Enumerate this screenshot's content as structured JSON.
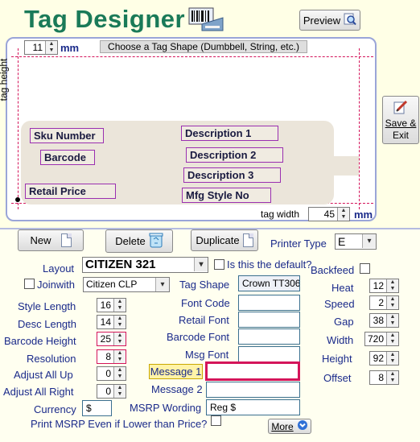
{
  "app": {
    "title": "Tag Designer"
  },
  "toolbar": {
    "preview_label": "Preview",
    "save_exit_label_1": "Save &",
    "save_exit_label_2": "Exit"
  },
  "canvas": {
    "height_value": "11",
    "height_unit": "mm",
    "height_axis_label": "tag height",
    "shape_hint": "Choose a Tag Shape (Dumbbell, String, etc.)",
    "width_label": "tag width",
    "width_value": "45",
    "width_unit": "mm",
    "fields": {
      "sku": "Sku Number",
      "barcode": "Barcode",
      "retail_price": "Retail Price",
      "desc1": "Description 1",
      "desc2": "Description 2",
      "desc3": "Description 3",
      "mfg_style": "Mfg Style No"
    }
  },
  "actions": {
    "new": "New",
    "delete": "Delete",
    "duplicate": "Duplicate"
  },
  "printer": {
    "label": "Printer Type",
    "value": "E"
  },
  "layout": {
    "label": "Layout",
    "value": "CITIZEN 321",
    "default_label": "Is this the default?",
    "joinwith_label": "Joinwith",
    "joinwith_value": "Citizen CLP"
  },
  "left_fields": {
    "style_length": {
      "label": "Style Length",
      "value": "16"
    },
    "desc_length": {
      "label": "Desc Length",
      "value": "14"
    },
    "barcode_height": {
      "label": "Barcode Height",
      "value": "25"
    },
    "resolution": {
      "label": "Resolution",
      "value": "8"
    },
    "adjust_up": {
      "label": "Adjust All Up",
      "value": "0"
    },
    "adjust_right": {
      "label": "Adjust All Right",
      "value": "0"
    },
    "currency": {
      "label": "Currency",
      "value": "$"
    }
  },
  "mid_fields": {
    "tag_shape": {
      "label": "Tag Shape",
      "value": "Crown TT306"
    },
    "font_code": {
      "label": "Font Code",
      "value": ""
    },
    "retail_font": {
      "label": "Retail Font",
      "value": ""
    },
    "barcode_font": {
      "label": "Barcode Font",
      "value": ""
    },
    "msg_font": {
      "label": "Msg Font",
      "value": ""
    },
    "message1": {
      "label": "Message 1",
      "value": ""
    },
    "message2": {
      "label": "Message 2",
      "value": ""
    },
    "msrp_wording": {
      "label": "MSRP Wording",
      "value": "Reg $"
    }
  },
  "right_fields": {
    "backfeed": {
      "label": "Backfeed"
    },
    "heat": {
      "label": "Heat",
      "value": "12"
    },
    "speed": {
      "label": "Speed",
      "value": "2"
    },
    "gap": {
      "label": "Gap",
      "value": "38"
    },
    "width": {
      "label": "Width",
      "value": "720"
    },
    "height": {
      "label": "Height",
      "value": "92"
    },
    "offset": {
      "label": "Offset",
      "value": "8"
    }
  },
  "footer": {
    "msrp_check_label": "Print MSRP Even if Lower than Price?",
    "more_label": "More"
  }
}
